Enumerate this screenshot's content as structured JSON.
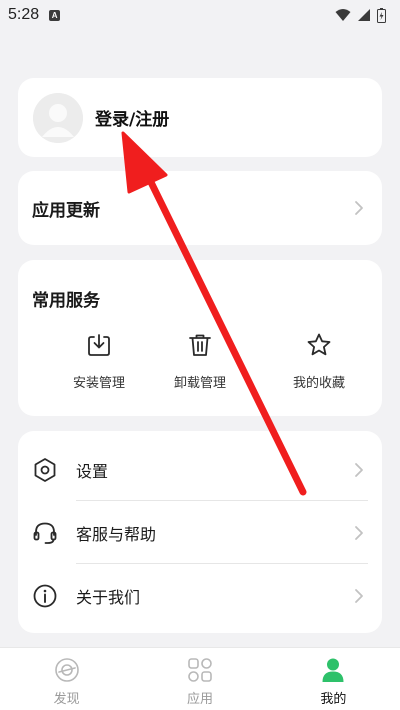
{
  "status_bar": {
    "time": "5:28",
    "notification_glyph": "A"
  },
  "login": {
    "label": "登录/注册"
  },
  "update": {
    "label": "应用更新"
  },
  "services": {
    "title": "常用服务",
    "items": [
      {
        "label": "安装管理",
        "icon": "download-icon"
      },
      {
        "label": "卸载管理",
        "icon": "trash-icon"
      },
      {
        "label": "我的收藏",
        "icon": "star-icon"
      }
    ]
  },
  "list": {
    "items": [
      {
        "label": "设置",
        "icon": "hexagon-settings-icon"
      },
      {
        "label": "客服与帮助",
        "icon": "headset-icon"
      },
      {
        "label": "关于我们",
        "icon": "info-icon"
      }
    ]
  },
  "nav": {
    "items": [
      {
        "label": "发现",
        "icon": "discover-icon"
      },
      {
        "label": "应用",
        "icon": "apps-grid-icon"
      },
      {
        "label": "我的",
        "icon": "profile-icon"
      }
    ],
    "active_color": "#2ec16a",
    "inactive_color": "#9a9a9a"
  },
  "annotation": {
    "arrow_color": "#f01e1e"
  }
}
